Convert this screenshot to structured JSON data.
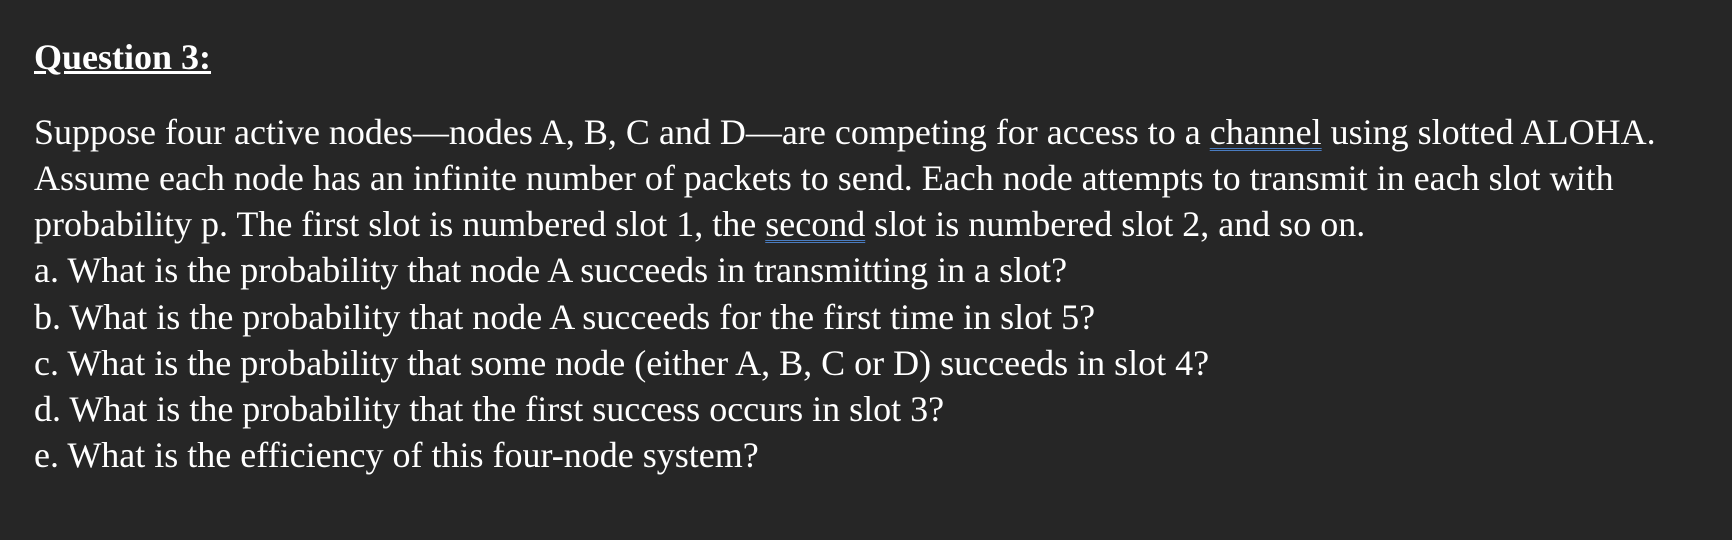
{
  "heading": "Question 3:",
  "intro": {
    "seg1": "Suppose four active nodes—nodes A, B, C and D—are competing for access to a ",
    "link1": "channel",
    "seg2": " using slotted ALOHA. Assume each node has an infinite number of packets to send. Each node attempts to transmit in each slot with probability p. The first slot is numbered slot 1, the ",
    "link2": "second",
    "seg3": " slot is numbered slot 2, and so on."
  },
  "parts": {
    "a": "a. What is the probability that node A succeeds in transmitting in a slot?",
    "b": "b. What is the probability that node A succeeds for the first time in slot 5?",
    "c": "c. What is the probability that some node (either A, B, C or D) succeeds in slot 4?",
    "d": "d. What is the probability that the first success occurs in slot 3?",
    "e": "e. What is the efficiency of this four-node system?"
  }
}
